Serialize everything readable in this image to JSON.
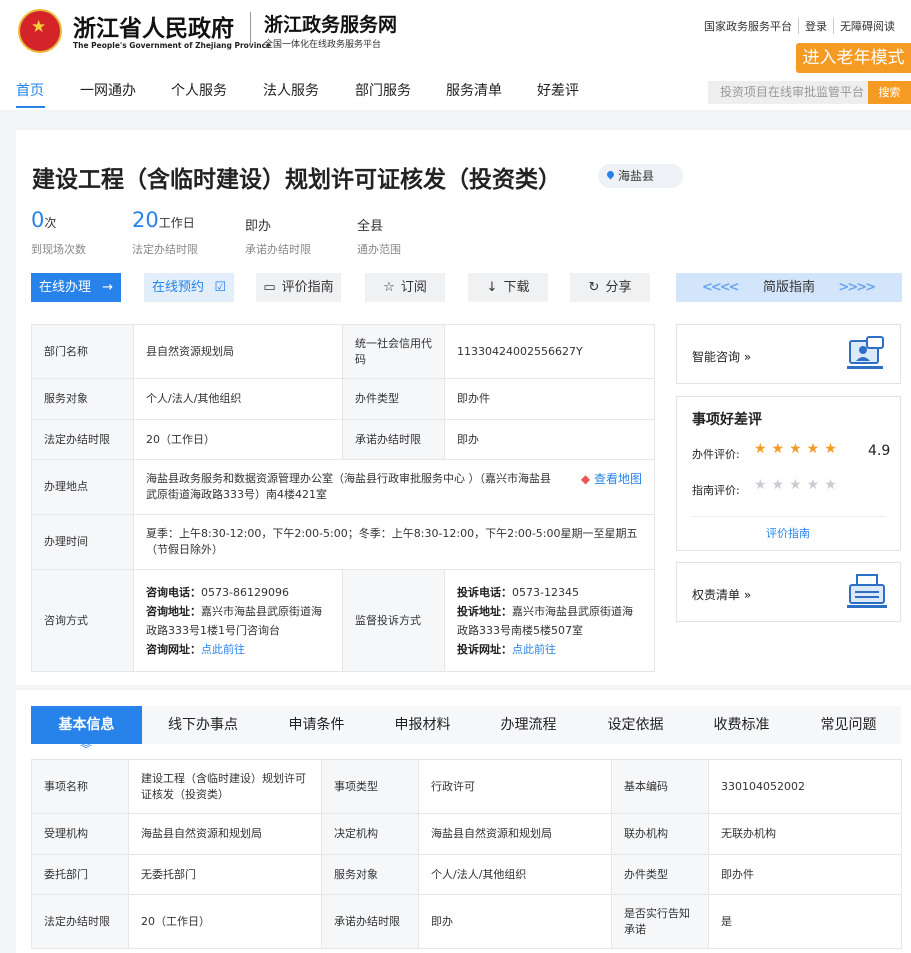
{
  "header": {
    "gov_name": "浙江省人民政府",
    "gov_en": "The People's Government of Zhejiang Province",
    "service_name": "浙江政务服务网",
    "service_sub": "全国一体化在线政务服务平台",
    "links": [
      "国家政务服务平台",
      "登录",
      "无障碍阅读"
    ],
    "elder_mode": "进入老年模式",
    "search_placeholder": "投资项目在线审批监管平台",
    "search_button": "搜索"
  },
  "nav": [
    "首页",
    "一网通办",
    "个人服务",
    "法人服务",
    "部门服务",
    "服务清单",
    "好差评"
  ],
  "item": {
    "title": "建设工程（含临时建设）规划许可证核发（投资类）",
    "location": "海盐县",
    "stats": [
      {
        "num": "0",
        "unit": "次",
        "label": "到现场次数"
      },
      {
        "num": "20",
        "unit": "工作日",
        "label": "法定办结时限"
      },
      {
        "text": "即办",
        "label": "承诺办结时限"
      },
      {
        "text": "全县",
        "label": "通办范围"
      }
    ]
  },
  "actions": {
    "online": "在线办理",
    "reserve": "在线预约",
    "guide": "评价指南",
    "subscribe": "订阅",
    "download": "下载",
    "share": "分享",
    "simple_guide": "简版指南"
  },
  "info": {
    "dept_label": "部门名称",
    "dept": "县自然资源规划局",
    "credit_label": "统一社会信用代码",
    "credit": "11330424002556627Y",
    "target_label": "服务对象",
    "target": "个人/法人/其他组织",
    "type_label": "办件类型",
    "type": "即办件",
    "legal_label": "法定办结时限",
    "legal": "20（工作日）",
    "promise_label": "承诺办结时限",
    "promise": "即办",
    "place_label": "办理地点",
    "place": "海盐县政务服务和数据资源管理办公室（海盐县行政审批服务中心 ）（嘉兴市海盐县武原街道海政路333号）南4楼421室",
    "map": "查看地图",
    "time_label": "办理时间",
    "time": "夏季：上午8:30-12:00，下午2:00-5:00；冬季：上午8:30-12:00，下午2:00-5:00星期一至星期五（节假日除外）",
    "consult_label": "咨询方式",
    "consult_phone_k": "咨询电话：",
    "consult_phone": "0573-86129096",
    "consult_addr_k": "咨询地址：",
    "consult_addr": "嘉兴市海盐县武原街道海政路333号1楼1号门咨询台",
    "consult_web_k": "咨询网址：",
    "consult_web": "点此前往",
    "complain_label": "监督投诉方式",
    "complain_phone_k": "投诉电话：",
    "complain_phone": "0573-12345",
    "complain_addr_k": "投诉地址：",
    "complain_addr": "嘉兴市海盐县武原街道海政路333号南楼5楼507室",
    "complain_web_k": "投诉网址：",
    "complain_web": "点此前往"
  },
  "side": {
    "smart": "智能咨询",
    "review_title": "事项好差评",
    "office_eval": "办件评价:",
    "office_score": "4.9",
    "office_rating": 5,
    "guide_eval": "指南评价:",
    "guide_rating": 0,
    "eval_guide": "评价指南",
    "power": "权责清单",
    "chev": "»",
    "star": "★★★★★"
  },
  "tabs": [
    "基本信息",
    "线下办事点",
    "申请条件",
    "申报材料",
    "办理流程",
    "设定依据",
    "收费标准",
    "常见问题"
  ],
  "basic": {
    "r1": [
      "事项名称",
      "建设工程（含临时建设）规划许可证核发（投资类）",
      "事项类型",
      "行政许可",
      "基本编码",
      "330104052002"
    ],
    "r2": [
      "受理机构",
      "海盐县自然资源和规划局",
      "决定机构",
      "海盐县自然资源和规划局",
      "联办机构",
      "无联办机构"
    ],
    "r3": [
      "委托部门",
      "无委托部门",
      "服务对象",
      "个人/法人/其他组织",
      "办件类型",
      "即办件"
    ],
    "r4": [
      "法定办结时限",
      "20（工作日）",
      "承诺办结时限",
      "即办",
      "是否实行告知承诺",
      "是"
    ]
  },
  "colors": {
    "accent": "#2783ea",
    "orange": "#f59a23",
    "star": "#f59a23"
  }
}
